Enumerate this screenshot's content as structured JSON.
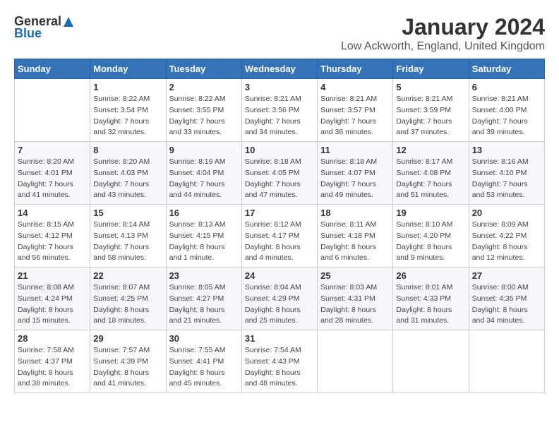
{
  "logo": {
    "general": "General",
    "blue": "Blue"
  },
  "title": "January 2024",
  "location": "Low Ackworth, England, United Kingdom",
  "headers": [
    "Sunday",
    "Monday",
    "Tuesday",
    "Wednesday",
    "Thursday",
    "Friday",
    "Saturday"
  ],
  "weeks": [
    [
      {
        "day": "",
        "info": ""
      },
      {
        "day": "1",
        "info": "Sunrise: 8:22 AM\nSunset: 3:54 PM\nDaylight: 7 hours\nand 32 minutes."
      },
      {
        "day": "2",
        "info": "Sunrise: 8:22 AM\nSunset: 3:55 PM\nDaylight: 7 hours\nand 33 minutes."
      },
      {
        "day": "3",
        "info": "Sunrise: 8:21 AM\nSunset: 3:56 PM\nDaylight: 7 hours\nand 34 minutes."
      },
      {
        "day": "4",
        "info": "Sunrise: 8:21 AM\nSunset: 3:57 PM\nDaylight: 7 hours\nand 36 minutes."
      },
      {
        "day": "5",
        "info": "Sunrise: 8:21 AM\nSunset: 3:59 PM\nDaylight: 7 hours\nand 37 minutes."
      },
      {
        "day": "6",
        "info": "Sunrise: 8:21 AM\nSunset: 4:00 PM\nDaylight: 7 hours\nand 39 minutes."
      }
    ],
    [
      {
        "day": "7",
        "info": "Sunrise: 8:20 AM\nSunset: 4:01 PM\nDaylight: 7 hours\nand 41 minutes."
      },
      {
        "day": "8",
        "info": "Sunrise: 8:20 AM\nSunset: 4:03 PM\nDaylight: 7 hours\nand 43 minutes."
      },
      {
        "day": "9",
        "info": "Sunrise: 8:19 AM\nSunset: 4:04 PM\nDaylight: 7 hours\nand 44 minutes."
      },
      {
        "day": "10",
        "info": "Sunrise: 8:18 AM\nSunset: 4:05 PM\nDaylight: 7 hours\nand 47 minutes."
      },
      {
        "day": "11",
        "info": "Sunrise: 8:18 AM\nSunset: 4:07 PM\nDaylight: 7 hours\nand 49 minutes."
      },
      {
        "day": "12",
        "info": "Sunrise: 8:17 AM\nSunset: 4:08 PM\nDaylight: 7 hours\nand 51 minutes."
      },
      {
        "day": "13",
        "info": "Sunrise: 8:16 AM\nSunset: 4:10 PM\nDaylight: 7 hours\nand 53 minutes."
      }
    ],
    [
      {
        "day": "14",
        "info": "Sunrise: 8:15 AM\nSunset: 4:12 PM\nDaylight: 7 hours\nand 56 minutes."
      },
      {
        "day": "15",
        "info": "Sunrise: 8:14 AM\nSunset: 4:13 PM\nDaylight: 7 hours\nand 58 minutes."
      },
      {
        "day": "16",
        "info": "Sunrise: 8:13 AM\nSunset: 4:15 PM\nDaylight: 8 hours\nand 1 minute."
      },
      {
        "day": "17",
        "info": "Sunrise: 8:12 AM\nSunset: 4:17 PM\nDaylight: 8 hours\nand 4 minutes."
      },
      {
        "day": "18",
        "info": "Sunrise: 8:11 AM\nSunset: 4:18 PM\nDaylight: 8 hours\nand 6 minutes."
      },
      {
        "day": "19",
        "info": "Sunrise: 8:10 AM\nSunset: 4:20 PM\nDaylight: 8 hours\nand 9 minutes."
      },
      {
        "day": "20",
        "info": "Sunrise: 8:09 AM\nSunset: 4:22 PM\nDaylight: 8 hours\nand 12 minutes."
      }
    ],
    [
      {
        "day": "21",
        "info": "Sunrise: 8:08 AM\nSunset: 4:24 PM\nDaylight: 8 hours\nand 15 minutes."
      },
      {
        "day": "22",
        "info": "Sunrise: 8:07 AM\nSunset: 4:25 PM\nDaylight: 8 hours\nand 18 minutes."
      },
      {
        "day": "23",
        "info": "Sunrise: 8:05 AM\nSunset: 4:27 PM\nDaylight: 8 hours\nand 21 minutes."
      },
      {
        "day": "24",
        "info": "Sunrise: 8:04 AM\nSunset: 4:29 PM\nDaylight: 8 hours\nand 25 minutes."
      },
      {
        "day": "25",
        "info": "Sunrise: 8:03 AM\nSunset: 4:31 PM\nDaylight: 8 hours\nand 28 minutes."
      },
      {
        "day": "26",
        "info": "Sunrise: 8:01 AM\nSunset: 4:33 PM\nDaylight: 8 hours\nand 31 minutes."
      },
      {
        "day": "27",
        "info": "Sunrise: 8:00 AM\nSunset: 4:35 PM\nDaylight: 8 hours\nand 34 minutes."
      }
    ],
    [
      {
        "day": "28",
        "info": "Sunrise: 7:58 AM\nSunset: 4:37 PM\nDaylight: 8 hours\nand 38 minutes."
      },
      {
        "day": "29",
        "info": "Sunrise: 7:57 AM\nSunset: 4:39 PM\nDaylight: 8 hours\nand 41 minutes."
      },
      {
        "day": "30",
        "info": "Sunrise: 7:55 AM\nSunset: 4:41 PM\nDaylight: 8 hours\nand 45 minutes."
      },
      {
        "day": "31",
        "info": "Sunrise: 7:54 AM\nSunset: 4:43 PM\nDaylight: 8 hours\nand 48 minutes."
      },
      {
        "day": "",
        "info": ""
      },
      {
        "day": "",
        "info": ""
      },
      {
        "day": "",
        "info": ""
      }
    ]
  ]
}
